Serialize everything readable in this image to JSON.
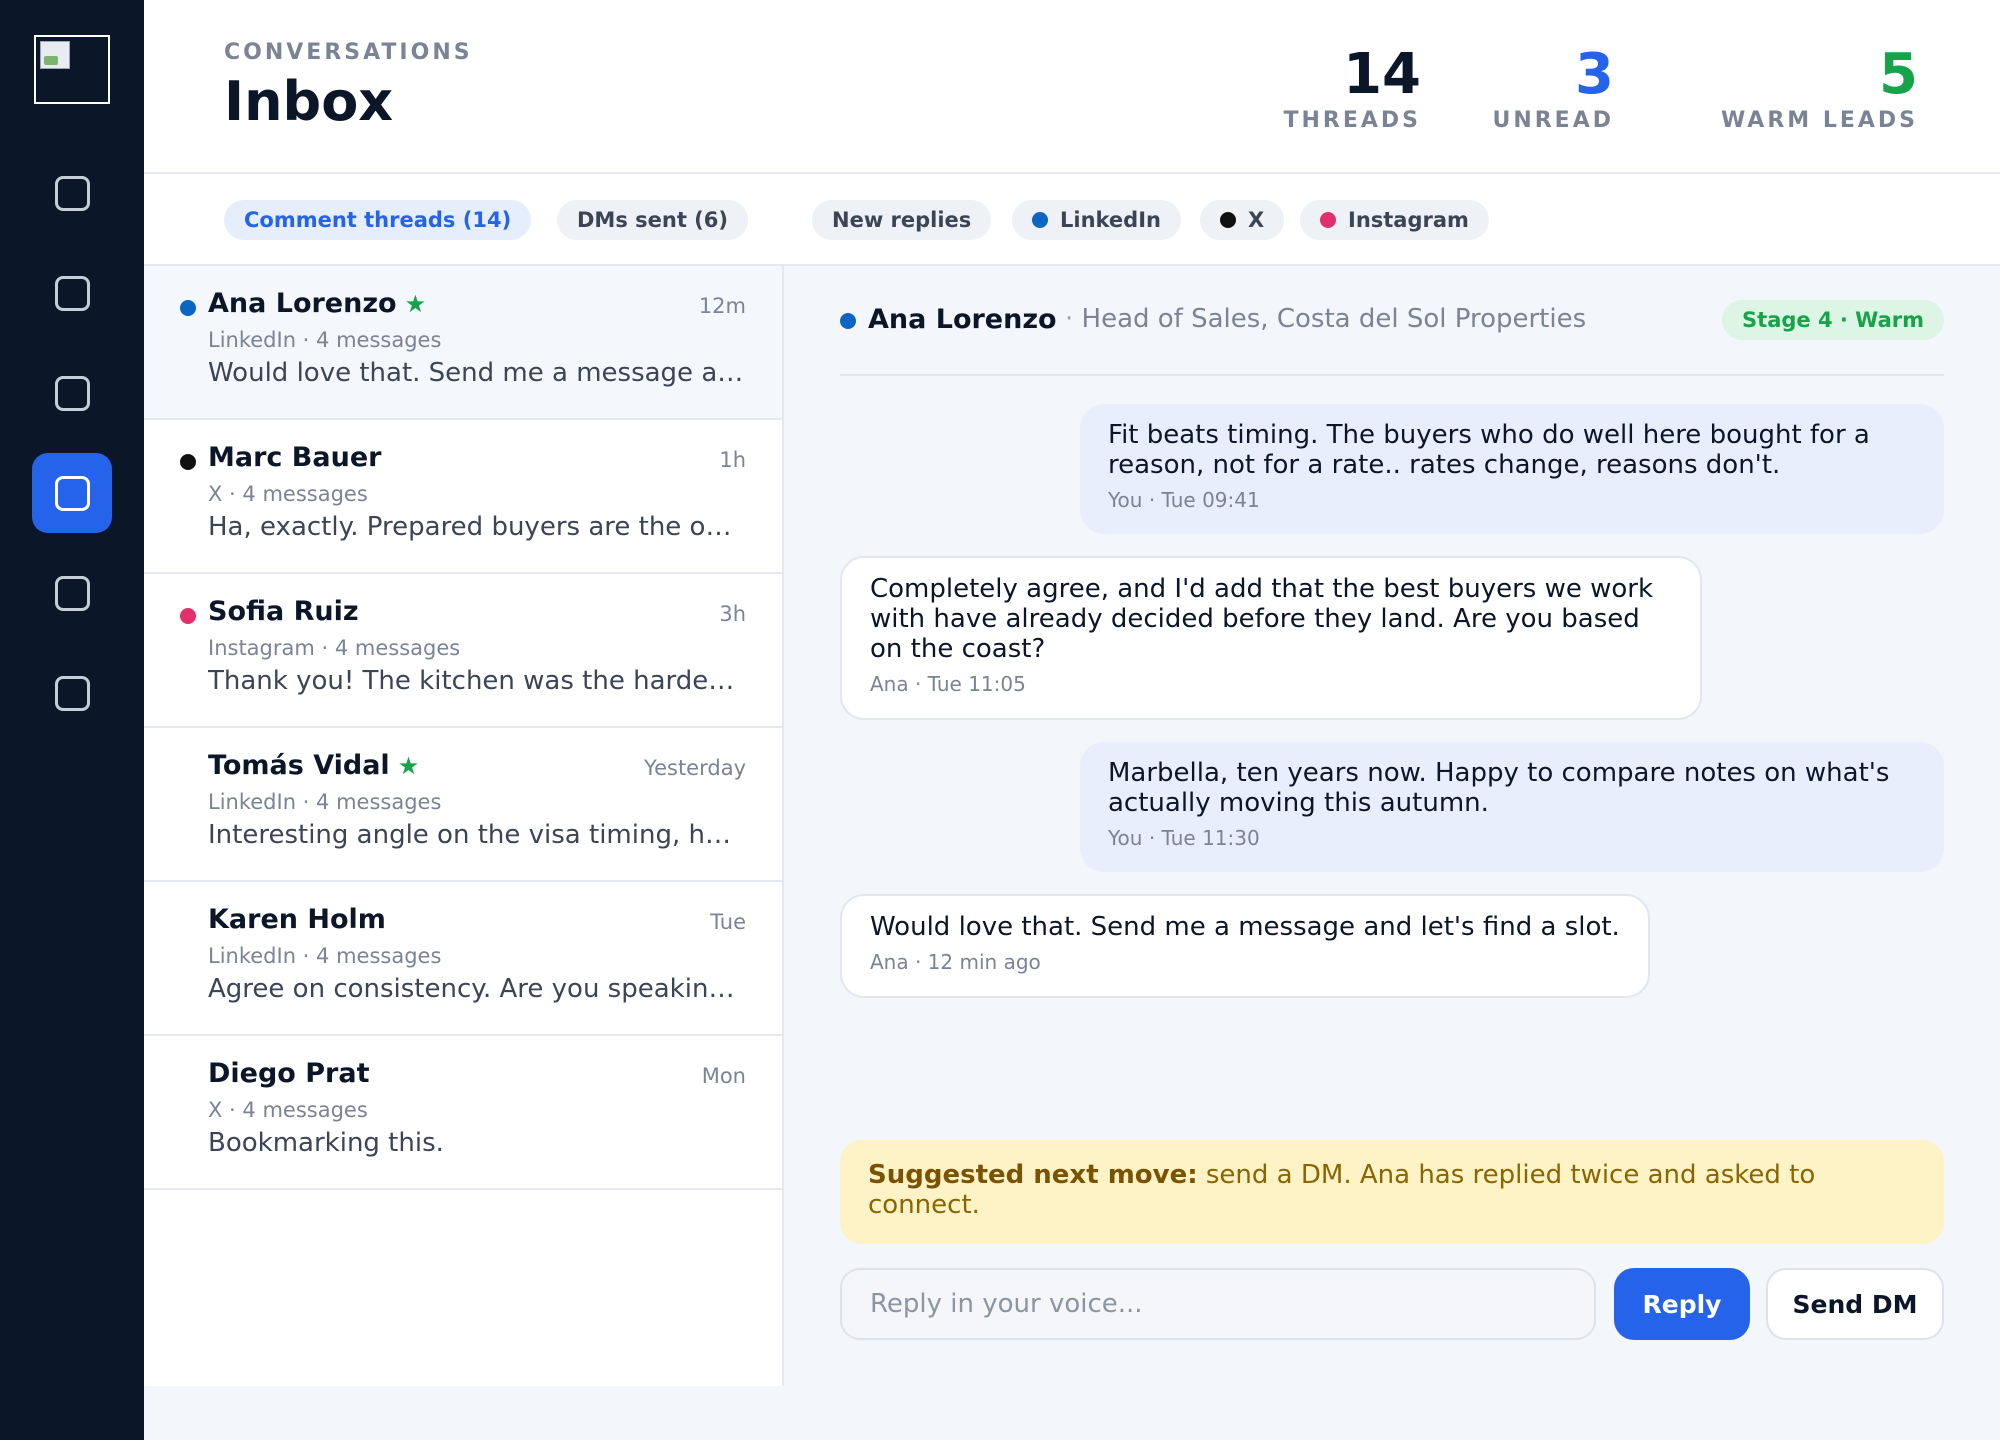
{
  "header": {
    "eyebrow": "CONVERSATIONS",
    "title": "Inbox",
    "stats": [
      {
        "value": "14",
        "label": "THREADS",
        "color": "#0c1629"
      },
      {
        "value": "3",
        "label": "UNREAD",
        "color": "#2563eb"
      },
      {
        "value": "5",
        "label": "WARM LEADS",
        "color": "#16a34a"
      }
    ]
  },
  "sidebar": {
    "logo_icon": "broken-image-icon",
    "nav_icons": [
      "nav-icon-1",
      "nav-icon-2",
      "nav-icon-3",
      "nav-icon-4",
      "nav-icon-5",
      "nav-icon-6"
    ],
    "active_index": 3
  },
  "filters": {
    "comment_threads": "Comment threads (14)",
    "dms_sent": "DMs sent (6)",
    "new_replies": "New replies",
    "linkedin": "LinkedIn",
    "x": "X",
    "instagram": "Instagram"
  },
  "platform_colors": {
    "LinkedIn": "#0a66c2",
    "X": "#111111",
    "Instagram": "#e1306c"
  },
  "threads": [
    {
      "name": "Ana Lorenzo",
      "starred": true,
      "unread": true,
      "platform": "LinkedIn",
      "time": "12m",
      "meta": "LinkedIn · 4 messages",
      "preview": "Would love that. Send me a message and let's find a slot."
    },
    {
      "name": "Marc Bauer",
      "starred": false,
      "unread": true,
      "platform": "X",
      "time": "1h",
      "meta": "X · 4 messages",
      "preview": "Ha, exactly. Prepared buyers are the only ones who close fast."
    },
    {
      "name": "Sofia Ruiz",
      "starred": false,
      "unread": true,
      "platform": "Instagram",
      "time": "3h",
      "meta": "Instagram · 4 messages",
      "preview": "Thank you! The kitchen was the hardest part to get right."
    },
    {
      "name": "Tomás Vidal",
      "starred": true,
      "unread": false,
      "platform": "LinkedIn",
      "time": "Yesterday",
      "meta": "LinkedIn · 4 messages",
      "preview": "Interesting angle on the visa timing, how are clients reacting?"
    },
    {
      "name": "Karen Holm",
      "starred": false,
      "unread": false,
      "platform": "LinkedIn",
      "time": "Tue",
      "meta": "LinkedIn · 4 messages",
      "preview": "Agree on consistency. Are you speaking at the event next month?"
    },
    {
      "name": "Diego Prat",
      "starred": false,
      "unread": false,
      "platform": "X",
      "time": "Mon",
      "meta": "X · 4 messages",
      "preview": "Bookmarking this."
    }
  ],
  "detail": {
    "name": "Ana Lorenzo",
    "separator": "·",
    "role": "Head of Sales, Costa del Sol Properties",
    "stage": "Stage 4 · Warm",
    "messages": [
      {
        "direction": "out",
        "text": "Fit beats timing. The buyers who do well here bought for a reason, not for a rate.. rates change, reasons don't.",
        "stamp": "You · Tue 09:41"
      },
      {
        "direction": "in",
        "text": "Completely agree, and I'd add that the best buyers we work with have already decided before they land. Are you based on the coast?",
        "stamp": "Ana · Tue 11:05"
      },
      {
        "direction": "out",
        "text": "Marbella, ten years now. Happy to compare notes on what's actually moving this autumn.",
        "stamp": "You · Tue 11:30"
      },
      {
        "direction": "in",
        "text": "Would love that. Send me a message and let's find a slot.",
        "stamp": "Ana · 12 min ago"
      }
    ],
    "suggestion_label": "Suggested next move:",
    "suggestion_text": "send a DM. Ana has replied twice and asked to connect."
  },
  "composer": {
    "placeholder": "Reply in your voice...",
    "value": "",
    "reply_label": "Reply",
    "dm_label": "Send DM"
  }
}
